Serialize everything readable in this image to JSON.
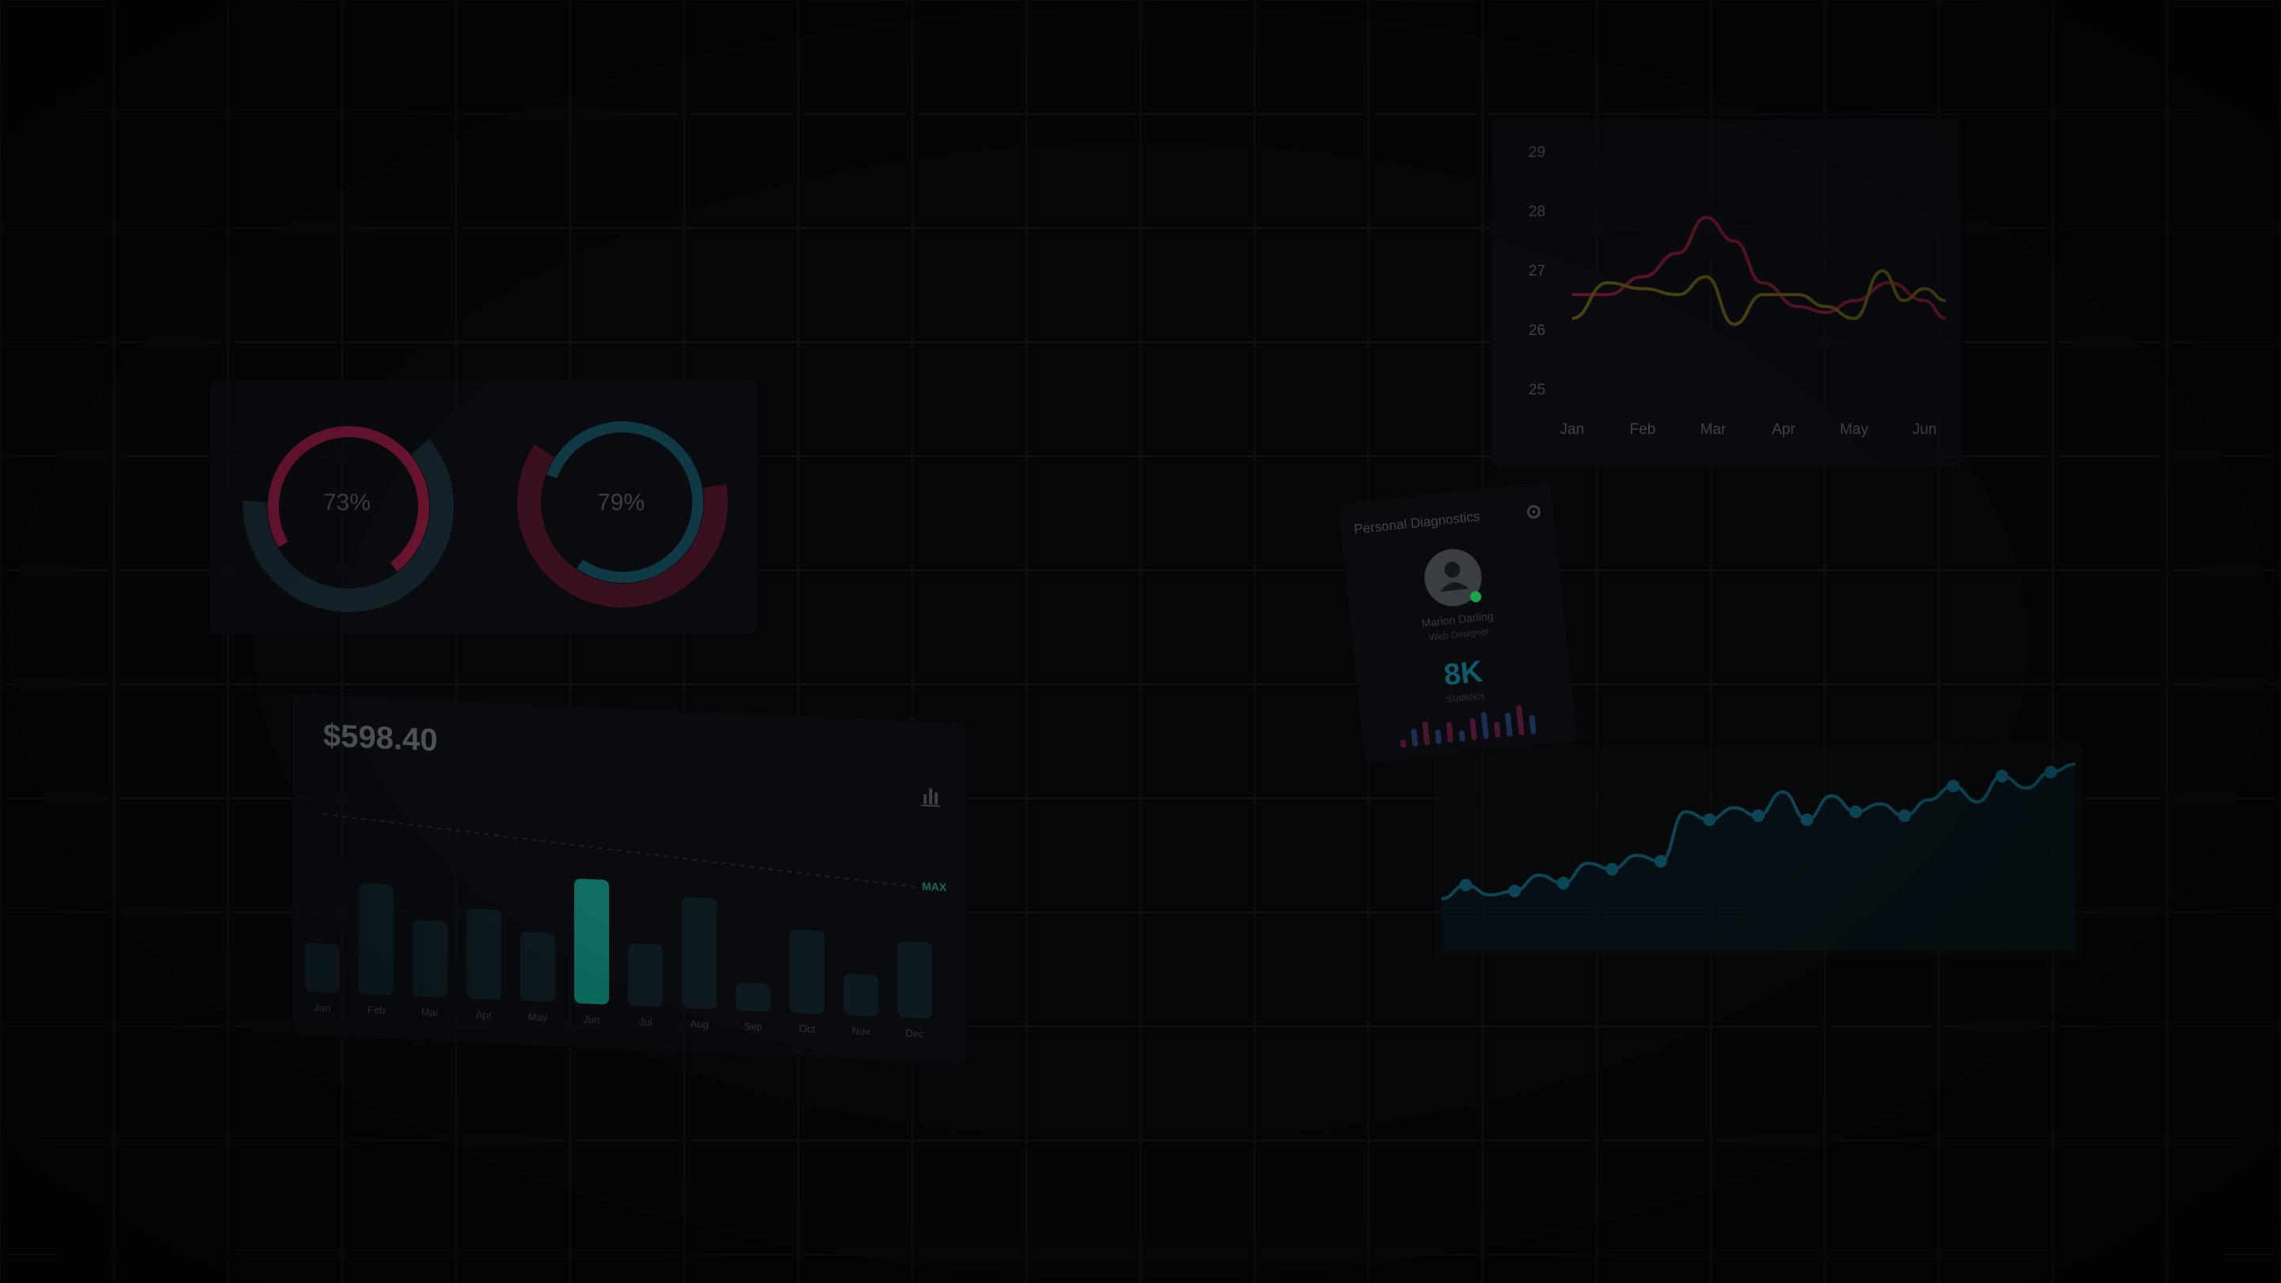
{
  "ring_gauges": [
    {
      "label": "73%",
      "value": 73,
      "color": "#6b1430",
      "track_color": "#13222a"
    },
    {
      "label": "79%",
      "value": 79,
      "color": "#0f3a45",
      "track_color": "#3a0f1f"
    }
  ],
  "revenue_card": {
    "amount": "$598.40",
    "max_label": "MAX",
    "chart_icon": "bar-chart-icon",
    "highlight_color": "#0e6e60",
    "bar_color": "#0d1a1f"
  },
  "diagnostics_card": {
    "title": "Personal Diagnostics",
    "user_name": "Marion Darling",
    "user_role": "Web Designer",
    "stat_value": "8K",
    "stat_caption": "Statistics",
    "avatar_icon": "user-avatar-icon",
    "settings_icon": "gear-icon",
    "status_color": "#1aa34a"
  },
  "chart_data": [
    {
      "type": "bar",
      "categories": [
        "Jan",
        "Feb",
        "Mar",
        "Apr",
        "May",
        "Jun",
        "Jul",
        "Aug",
        "Sep",
        "Oct",
        "Nov",
        "Dec"
      ],
      "values": [
        35,
        80,
        55,
        65,
        50,
        90,
        45,
        80,
        20,
        60,
        30,
        55
      ],
      "highlight_index": 5,
      "ylim": [
        0,
        100
      ],
      "grid": false
    },
    {
      "type": "line",
      "categories": [
        "Jan",
        "Feb",
        "Mar",
        "Apr",
        "May",
        "Jun"
      ],
      "yticks": [
        25,
        26,
        27,
        28,
        29
      ],
      "ylim": [
        25,
        29
      ],
      "series": [
        {
          "color": "#5e1428",
          "x": [
            0,
            0.5,
            1,
            1.5,
            1.9,
            2.3,
            2.7,
            3.2,
            3.6,
            4,
            4.5,
            5,
            5.3
          ],
          "y": [
            26.6,
            26.6,
            26.9,
            27.3,
            27.9,
            27.5,
            26.8,
            26.4,
            26.3,
            26.5,
            26.8,
            26.5,
            26.2
          ]
        },
        {
          "color": "#4a4310",
          "x": [
            0,
            0.5,
            1,
            1.5,
            1.9,
            2.3,
            2.7,
            3.2,
            3.6,
            4,
            4.4,
            4.7,
            5,
            5.3
          ],
          "y": [
            26.2,
            26.8,
            26.7,
            26.6,
            26.9,
            26.1,
            26.6,
            26.6,
            26.4,
            26.2,
            27.0,
            26.5,
            26.7,
            26.5
          ]
        }
      ],
      "grid": false
    },
    {
      "type": "area",
      "color": "#0b4656",
      "y": [
        18,
        25,
        20,
        22,
        30,
        26,
        36,
        33,
        40,
        37,
        62,
        58,
        64,
        60,
        72,
        58,
        70,
        62,
        66,
        60,
        68,
        75,
        67,
        80,
        74,
        82,
        86
      ]
    }
  ]
}
